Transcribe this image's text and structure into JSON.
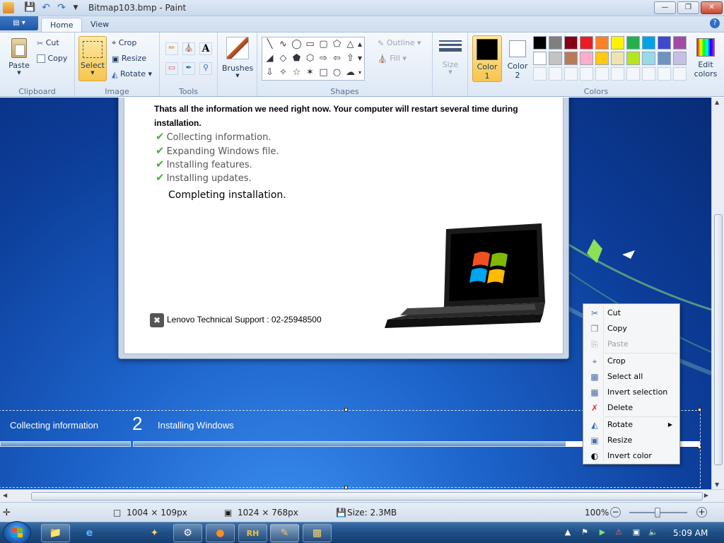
{
  "window": {
    "title": "Bitmap103.bmp - Paint",
    "minimize": "—",
    "maximize": "❐",
    "close": "✕"
  },
  "ribbon": {
    "tabs": [
      {
        "label": "Home"
      },
      {
        "label": "View"
      }
    ],
    "clipboard": {
      "paste": "Paste",
      "cut": "Cut",
      "copy": "Copy",
      "label": "Clipboard"
    },
    "image": {
      "select": "Select",
      "crop": "Crop",
      "resize": "Resize",
      "rotate": "Rotate",
      "label": "Image"
    },
    "tools": {
      "label": "Tools",
      "text_tool": "A"
    },
    "brushes": {
      "label": "Brushes"
    },
    "shapes": {
      "label": "Shapes",
      "outline": "Outline",
      "fill": "Fill"
    },
    "size": {
      "label": "Size"
    },
    "colors": {
      "color1_line1": "Color",
      "color1_line2": "1",
      "color2_line1": "Color",
      "color2_line2": "2",
      "edit_line1": "Edit",
      "edit_line2": "colors",
      "label": "Colors",
      "color1": "#000000",
      "color2": "#ffffff",
      "palette_row1": [
        "#000000",
        "#7f7f7f",
        "#880015",
        "#ed1c24",
        "#ff7f27",
        "#fff200",
        "#22b14c",
        "#00a2e8",
        "#3f48cc",
        "#a349a4"
      ],
      "palette_row2": [
        "#ffffff",
        "#c3c3c3",
        "#b97a57",
        "#ffaec9",
        "#ffc90e",
        "#efe4b0",
        "#b5e61d",
        "#99d9ea",
        "#7092be",
        "#c8bfe7"
      ]
    }
  },
  "canvas": {
    "dialog": {
      "message": "Thats all the information we need right now. Your computer will restart several time during installation.",
      "steps": [
        "Collecting information.",
        "Expanding Windows file.",
        "Installing features.",
        "Installing updates."
      ],
      "current_step": "Completing installation.",
      "support": "Lenovo Technical Support : 02-25948500"
    },
    "progress": {
      "step1": "Collecting information",
      "step2_number": "2",
      "step2": "Installing Windows"
    }
  },
  "context_menu": {
    "items": [
      {
        "label": "Cut",
        "icon": "scissors-icon"
      },
      {
        "label": "Copy",
        "icon": "copy-icon"
      },
      {
        "label": "Paste",
        "icon": "paste-icon",
        "disabled": true
      },
      {
        "label": "Crop",
        "icon": "crop-icon"
      },
      {
        "label": "Select all",
        "icon": "select-all-icon"
      },
      {
        "label": "Invert selection",
        "icon": "invert-selection-icon"
      },
      {
        "label": "Delete",
        "icon": "delete-icon"
      },
      {
        "label": "Rotate",
        "icon": "rotate-icon",
        "submenu": true
      },
      {
        "label": "Resize",
        "icon": "resize-icon"
      },
      {
        "label": "Invert color",
        "icon": "invert-color-icon"
      }
    ]
  },
  "status": {
    "selection_size": "1004 × 109px",
    "image_size": "1024 × 768px",
    "file_size": "Size: 2.3MB",
    "zoom": "100%"
  },
  "taskbar": {
    "clock": "5:09 AM"
  }
}
